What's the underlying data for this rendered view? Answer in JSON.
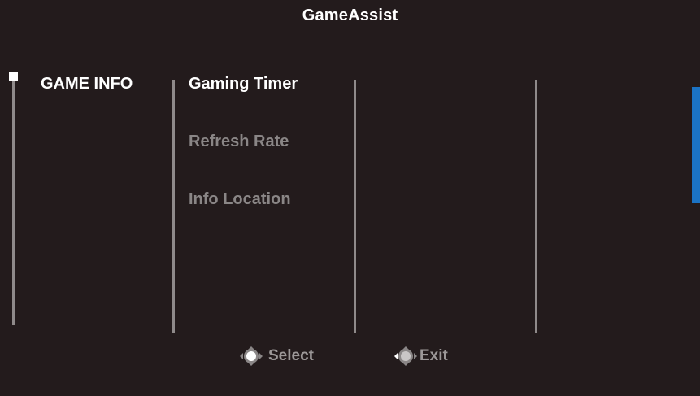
{
  "window": {
    "title": "GameAssist"
  },
  "columns": {
    "main": {
      "items": [
        {
          "label": "GAME INFO",
          "state": "selected"
        }
      ]
    },
    "sub": {
      "items": [
        {
          "label": "Gaming Timer",
          "state": "highlighted"
        },
        {
          "label": "Refresh Rate",
          "state": "normal"
        },
        {
          "label": "Info Location",
          "state": "normal"
        }
      ]
    }
  },
  "footer": {
    "select": {
      "label": "Select",
      "icon": "joystick-press-icon"
    },
    "exit": {
      "label": "Exit",
      "icon": "joystick-left-icon"
    }
  },
  "colors": {
    "background": "#231b1c",
    "text_active": "#ffffff",
    "text_dim": "#8a8686",
    "divider": "#8f8a8a",
    "accent": "#1b73c4"
  }
}
